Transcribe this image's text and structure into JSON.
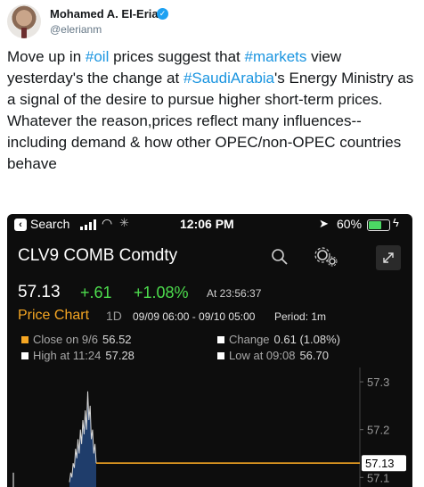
{
  "tweet": {
    "author_name": "Mohamed A. El-Erian",
    "handle": "@elerianm",
    "text_parts": [
      "Move up in ",
      "#oil",
      " prices suggest that ",
      "#markets",
      " view yesterday's the change at ",
      "#SaudiArabia",
      "'s Energy Ministry as a signal of the desire to pursue higher short-term prices."
    ],
    "line2": "Whatever the reason,prices reflect many influences--including demand & how other OPEC/non-OPEC countries behave"
  },
  "statusbar": {
    "back_app": "Search",
    "time": "12:06 PM",
    "battery": "60%"
  },
  "quote": {
    "ticker": "CLV9 COMB Comdty",
    "last": "57.13",
    "change": "+.61",
    "change_pct": "+1.08%",
    "as_of": "At 23:56:37"
  },
  "price_chart": {
    "title": "Price Chart",
    "interval": "1D",
    "range": "09/09 06:00 - 09/10 05:00",
    "period": "Period: 1m"
  },
  "legend": {
    "close_label": "Close on 9/6",
    "close_value": "56.52",
    "change_label": "Change",
    "change_value": "0.61 (1.08%)",
    "high_label": "High at 11:24",
    "high_value": "57.28",
    "low_label": "Low at 09:08",
    "low_value": "56.70"
  },
  "colors": {
    "hashtag": "#1b95e0",
    "positive": "#4ddc4d",
    "accent": "#f5a623",
    "area_fill": "#1f3d6b"
  },
  "chart_data": {
    "type": "area",
    "y_ticks": [
      "57.3",
      "57.2",
      "57.1"
    ],
    "last_value_label": "57.13",
    "ylim": [
      57.08,
      57.33
    ],
    "close_line": 57.13,
    "values": [
      57.09,
      57.11,
      57.1,
      57.13,
      57.12,
      57.16,
      57.14,
      57.18,
      57.15,
      57.2,
      57.17,
      57.22,
      57.19,
      57.24,
      57.2,
      57.28,
      57.22,
      57.25,
      57.18,
      57.2,
      57.15,
      57.17,
      57.13
    ]
  }
}
